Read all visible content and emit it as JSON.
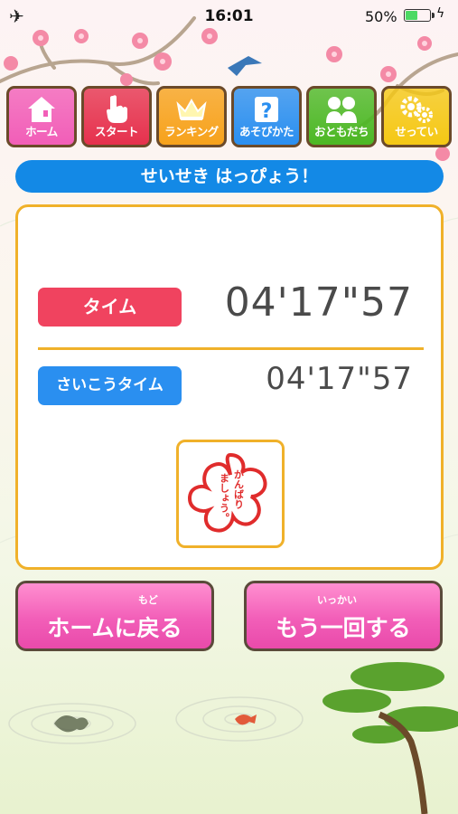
{
  "status_bar": {
    "time": "16:01",
    "battery_percent": "50%",
    "battery_level": 0.5
  },
  "nav": {
    "items": [
      {
        "label": "ホーム",
        "color": "#f25eb8",
        "icon": "house-icon"
      },
      {
        "label": "スタート",
        "color": "#e6314d",
        "icon": "pointing-hand-icon"
      },
      {
        "label": "ランキング",
        "color": "#f7a21b",
        "icon": "crown-icon"
      },
      {
        "label": "あそびかた",
        "color": "#2a8ff0",
        "icon": "question-icon"
      },
      {
        "label": "おともだち",
        "color": "#4cb824",
        "icon": "friends-icon"
      },
      {
        "label": "せってい",
        "color": "#f5c814",
        "icon": "gears-icon"
      }
    ]
  },
  "banner": {
    "title": "せいせき はっぴょう！"
  },
  "result": {
    "time_label": "タイム",
    "time_value": "04'17\"57",
    "best_label": "さいこうタイム",
    "best_value": "04'17\"57",
    "stamp_line1": "がんばり",
    "stamp_line2": "ましょう。"
  },
  "actions": {
    "home": {
      "label": "ホームに戻る",
      "ruby": "もど"
    },
    "retry": {
      "label": "もう一回する",
      "ruby": "いっかい"
    }
  }
}
